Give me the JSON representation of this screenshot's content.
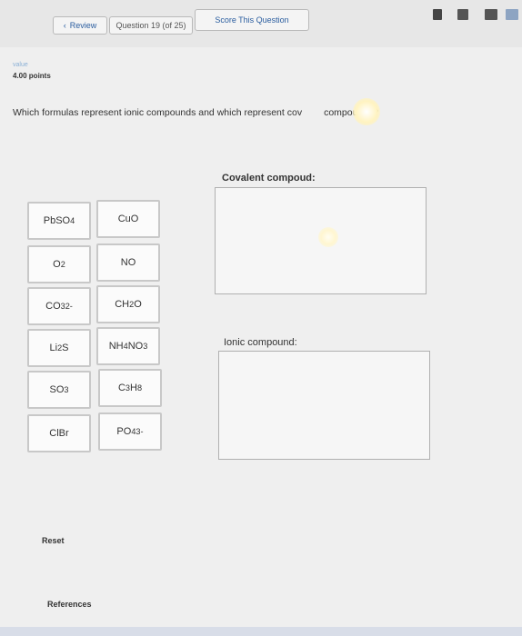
{
  "header": {
    "review_label": "Review",
    "question_counter": "Question 19 (of 25)",
    "score_label": "Score This Question"
  },
  "question_meta": {
    "value_label": "value",
    "points": "4.00 points"
  },
  "question": {
    "text_before": "Which formulas represent ionic compounds and which represent cov",
    "text_after": "compounds?"
  },
  "zones": {
    "covalent_title": "Covalent compoud:",
    "ionic_title": "Ionic compound:"
  },
  "tiles": [
    {
      "html": "PbSO<sub>4</sub>"
    },
    {
      "html": "CuO"
    },
    {
      "html": "O<sub>2</sub>"
    },
    {
      "html": "NO"
    },
    {
      "html": "CO<sub>3</sub><sup>2-</sup>"
    },
    {
      "html": "CH<sub>2</sub>O"
    },
    {
      "html": "Li<sub>2</sub>S"
    },
    {
      "html": "NH<sub>4</sub>NO<sub>3</sub>"
    },
    {
      "html": "SO<sub>3</sub>"
    },
    {
      "html": "C<sub>3</sub>H<sub>8</sub>"
    },
    {
      "html": "ClBr"
    },
    {
      "html": "PO<sub>4</sub><sup>3-</sup>"
    }
  ],
  "footer": {
    "reset_label": "Reset",
    "references_label": "References"
  },
  "icons": [
    "chevron-left-icon",
    "calculator-icon",
    "print-icon",
    "book-icon",
    "help-icon"
  ]
}
